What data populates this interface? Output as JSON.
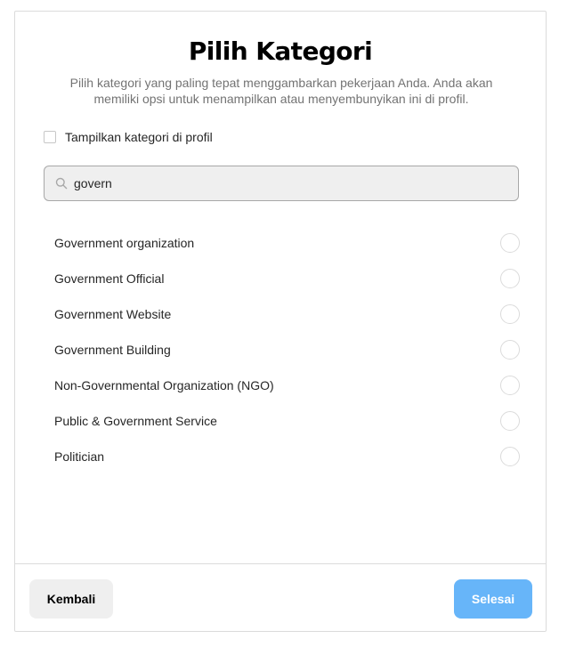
{
  "dialog": {
    "title": "Pilih Kategori",
    "subtitle": "Pilih kategori yang paling tepat menggambarkan pekerjaan Anda. Anda akan memiliki opsi untuk menampilkan atau menyembunyikan ini di profil."
  },
  "show_on_profile": {
    "label": "Tampilkan kategori di profil",
    "checked": false
  },
  "search": {
    "value": "govern",
    "icon": "search-icon"
  },
  "categories": [
    {
      "label": "Government organization",
      "selected": false
    },
    {
      "label": "Government Official",
      "selected": false
    },
    {
      "label": "Government Website",
      "selected": false
    },
    {
      "label": "Government Building",
      "selected": false
    },
    {
      "label": "Non-Governmental Organization (NGO)",
      "selected": false
    },
    {
      "label": "Public & Government Service",
      "selected": false
    },
    {
      "label": "Politician",
      "selected": false
    }
  ],
  "footer": {
    "back_label": "Kembali",
    "done_label": "Selesai"
  },
  "colors": {
    "primary_disabled": "#67b5f9",
    "secondary_button": "#efefef",
    "border": "#dbdbdb"
  }
}
